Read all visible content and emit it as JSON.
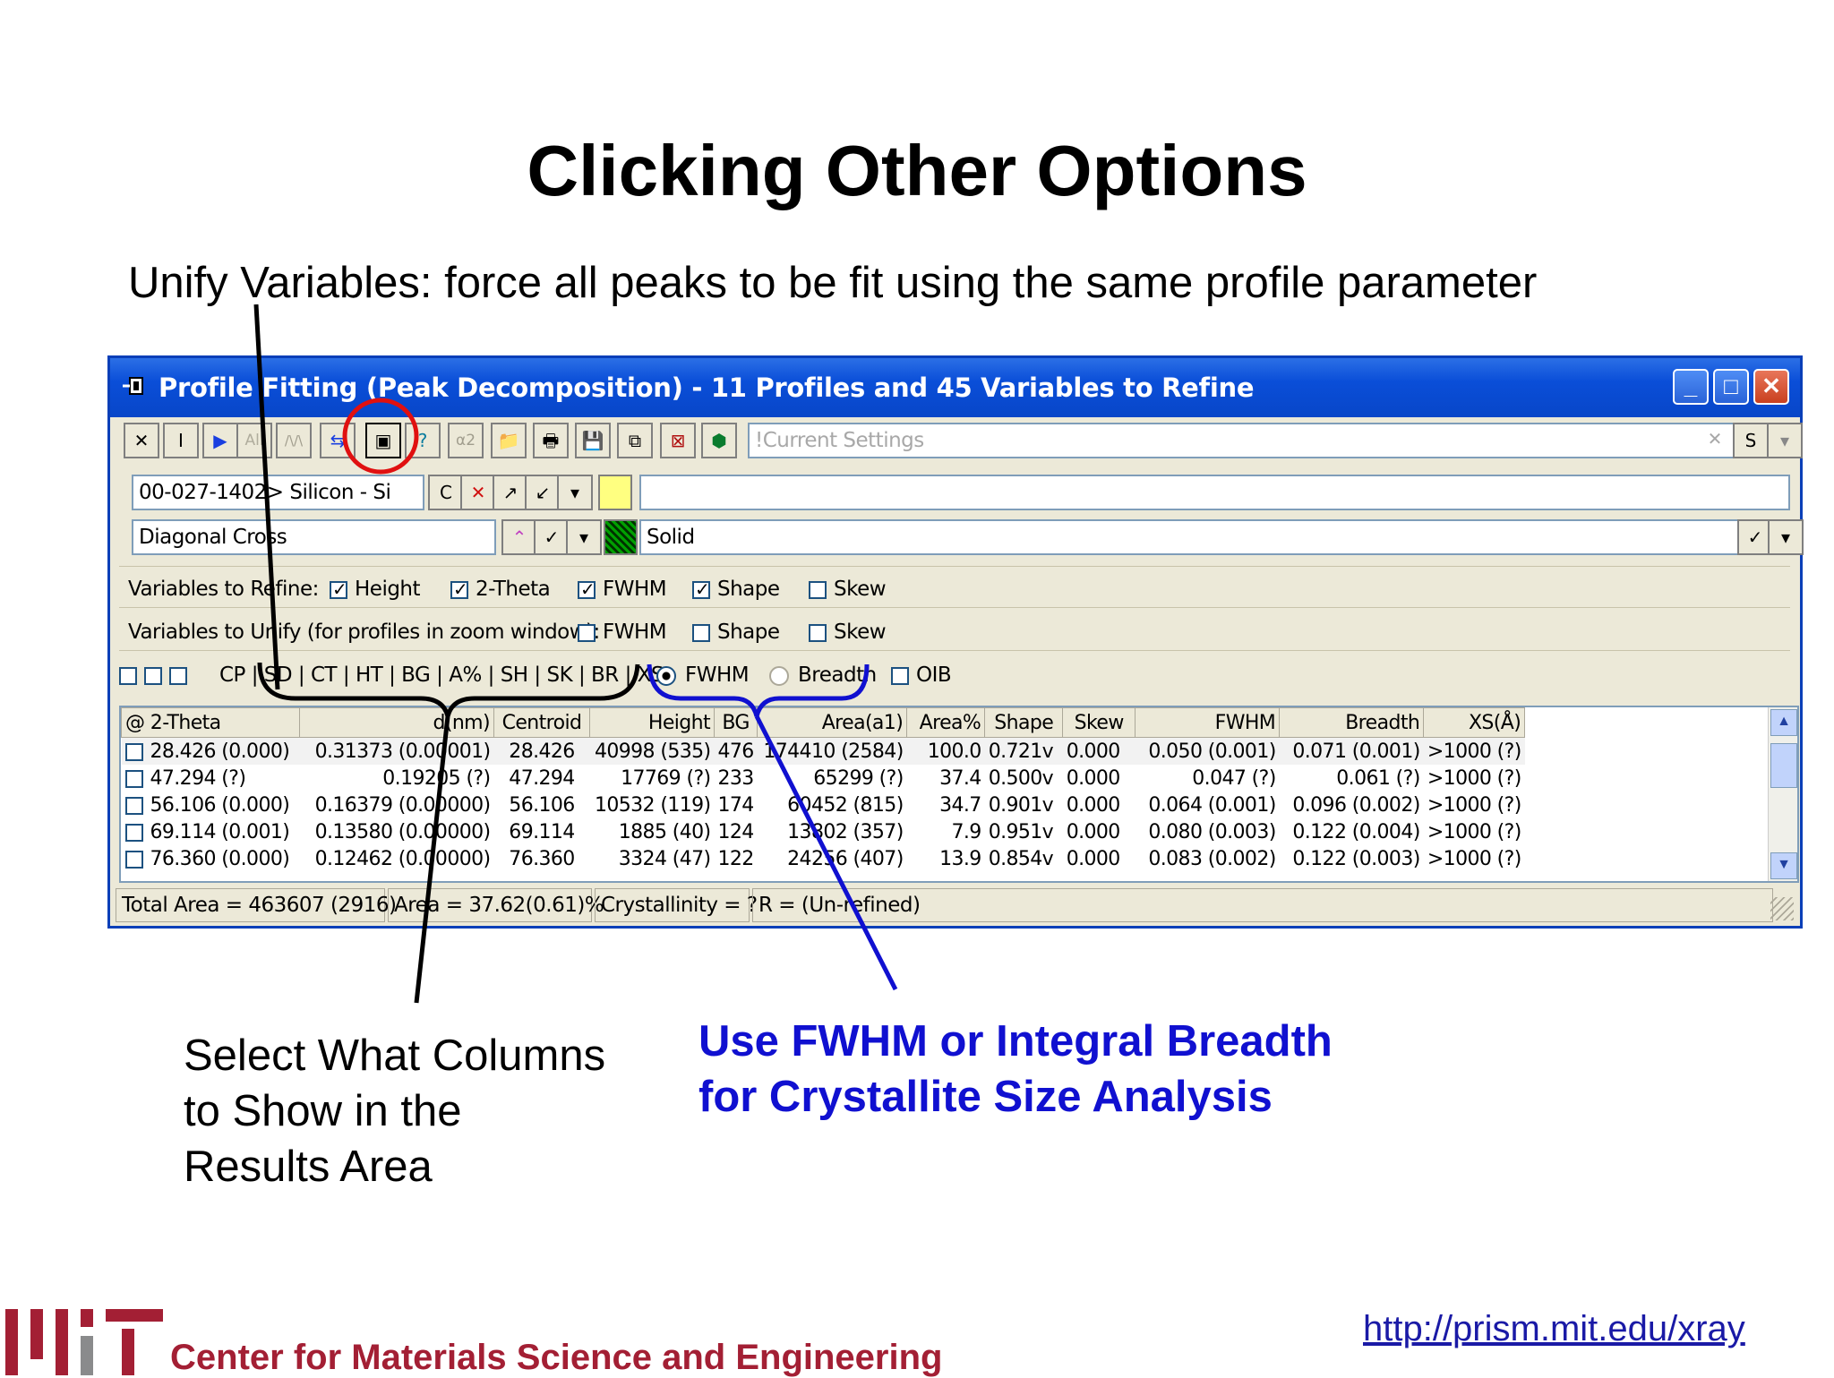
{
  "slide": {
    "title": "Clicking Other Options",
    "subtitle": "Unify Variables: force all peaks to be fit using the same profile parameter",
    "note_columns": [
      "Select What Columns",
      "to Show in the",
      "Results Area"
    ],
    "note_fwhm": [
      "Use FWHM or Integral Breadth",
      "for Crystallite Size Analysis"
    ],
    "footer_text": "Center for Materials Science and Engineering",
    "footer_link": "http://prism.mit.edu/xray",
    "colors": {
      "accent_blue": "#1010d0",
      "mit_red": "#a31f34",
      "highlight_circle": "#e01010"
    }
  },
  "window": {
    "title": "Profile Fitting (Peak Decomposition) - 11 Profiles and 45 Variables to Refine",
    "icon": "pin-icon",
    "buttons": {
      "minimize": "_",
      "maximize": "□",
      "close": "✕"
    },
    "toolbar": {
      "buttons": [
        "✕",
        "I",
        "▶",
        "All",
        "/\\/\\",
        "⇆",
        "▣",
        "?",
        "α2",
        "📁",
        "🖶",
        "💾",
        "⧉",
        "⊠",
        "⬢"
      ],
      "settings_placeholder": "!Current Settings",
      "clear": "✕",
      "save": "S",
      "dropdown": "▾"
    },
    "phase": {
      "value": "00-027-1402> Silicon - Si",
      "c_button": "C",
      "x_button": "✕",
      "pattern_value": "Diagonal Cross",
      "line_value": "Solid",
      "yellow_color": "#ffff80"
    },
    "refine": {
      "label": "Variables to Refine:",
      "options": [
        {
          "label": "Height",
          "checked": true
        },
        {
          "label": "2-Theta",
          "checked": true
        },
        {
          "label": "FWHM",
          "checked": true
        },
        {
          "label": "Shape",
          "checked": true
        },
        {
          "label": "Skew",
          "checked": false
        }
      ]
    },
    "unify": {
      "label": "Variables to Unify (for profiles in zoom window):",
      "options": [
        {
          "label": "FWHM",
          "checked": false
        },
        {
          "label": "Shape",
          "checked": false
        },
        {
          "label": "Skew",
          "checked": false
        }
      ]
    },
    "columns_row": {
      "codes": "CP | SD | CT | HT | BG | A% | SH | SK | BR | XS:",
      "radio_fwhm": "FWHM",
      "radio_breadth": "Breadth",
      "oib": "OIB",
      "selected": "FWHM"
    },
    "table": {
      "headers": [
        "@ 2-Theta",
        "d(nm)",
        "Centroid",
        "Height",
        "BG",
        "Area(a1)",
        "Area%",
        "Shape",
        "Skew",
        "FWHM",
        "Breadth",
        "XS(Å)"
      ],
      "rows": [
        [
          "28.426 (0.000)",
          "0.31373 (0.00001)",
          "28.426",
          "40998 (535)",
          "476",
          "174410 (2584)",
          "100.0",
          "0.721v",
          "0.000",
          "0.050 (0.001)",
          "0.071 (0.001)",
          ">1000 (?)"
        ],
        [
          "47.294 (?)",
          "0.19205 (?)",
          "47.294",
          "17769 (?)",
          "233",
          "65299 (?)",
          "37.4",
          "0.500v",
          "0.000",
          "0.047 (?)",
          "0.061 (?)",
          ">1000 (?)"
        ],
        [
          "56.106 (0.000)",
          "0.16379 (0.00000)",
          "56.106",
          "10532 (119)",
          "174",
          "60452 (815)",
          "34.7",
          "0.901v",
          "0.000",
          "0.064 (0.001)",
          "0.096 (0.002)",
          ">1000 (?)"
        ],
        [
          "69.114 (0.001)",
          "0.13580 (0.00000)",
          "69.114",
          "1885 (40)",
          "124",
          "13802 (357)",
          "7.9",
          "0.951v",
          "0.000",
          "0.080 (0.003)",
          "0.122 (0.004)",
          ">1000 (?)"
        ],
        [
          "76.360 (0.000)",
          "0.12462 (0.00000)",
          "76.360",
          "3324 (47)",
          "122",
          "24256 (407)",
          "13.9",
          "0.854v",
          "0.000",
          "0.083 (0.002)",
          "0.122 (0.003)",
          ">1000 (?)"
        ]
      ]
    },
    "status": {
      "total_area": "Total Area = 463607 (2916)",
      "area": "Area = 37.62(0.61)%",
      "crystallinity": "Crystallinity = ?",
      "r": "R = (Un-refined)"
    }
  }
}
